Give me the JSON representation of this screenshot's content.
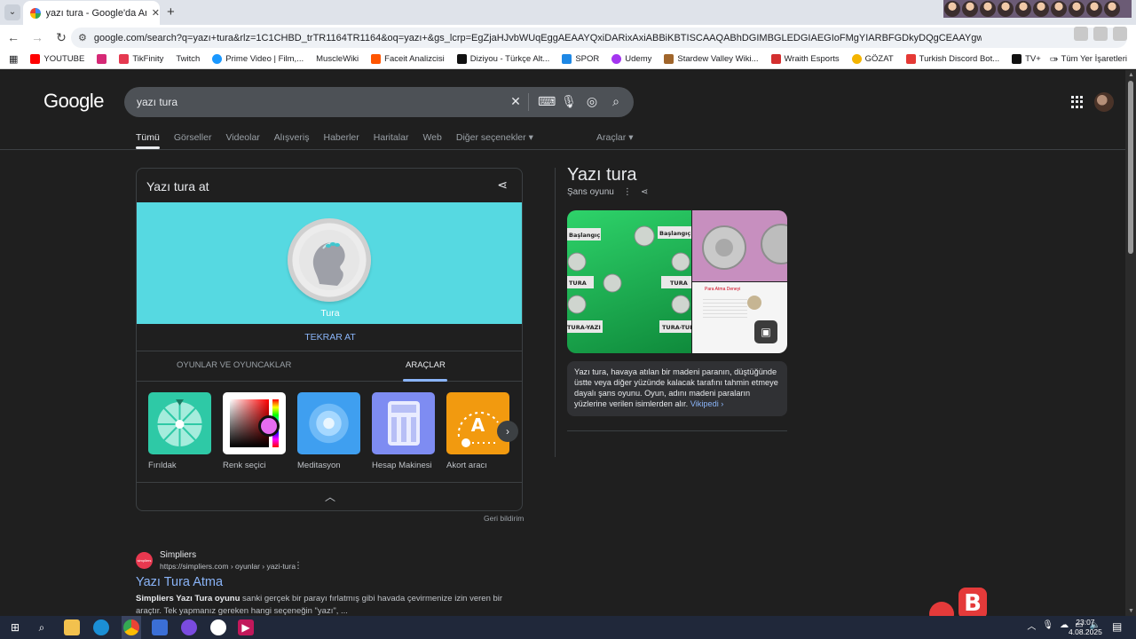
{
  "browser": {
    "tab_title": "yazı tura - Google'da Ara",
    "url": "google.com/search?q=yazı+tura&rlz=1C1CHBD_trTR1164TR1164&oq=yazı+&gs_lcrp=EgZjaHJvbWUqEggAEAAYQxiDARixAxiABBiKBTISCAAQABhDGIMBGLEDGIAEGIoFMgYIARBFGDkyDQgCEAAYgwEYsQMYgAQyDQgDEAAYgwEYsQMYgAQyDQgEEAAYgwEYsQMYg...",
    "bookmarks": [
      "YOUTUBE",
      "TikFinity",
      "Twitch",
      "Prime Video | Film,...",
      "MuscleWiki",
      "Faceit Analizcisi",
      "Diziyou - Türkçe Alt...",
      "SPOR",
      "Udemy",
      "Stardew Valley Wiki...",
      "Wraith Esports",
      "GÖZAT",
      "Turkish Discord Bot...",
      "TV+"
    ],
    "bookmarks_more": "»",
    "all_bookmarks": "Tüm Yer İşaretleri"
  },
  "search": {
    "logo": "Google",
    "query": "yazı tura",
    "tabs": [
      "Tümü",
      "Görseller",
      "Videolar",
      "Alışveriş",
      "Haberler",
      "Haritalar",
      "Web",
      "Diğer seçenekler"
    ],
    "tools": "Araçlar"
  },
  "coin_flip": {
    "title": "Yazı tura at",
    "result": "Tura",
    "flip_again": "TEKRAR AT",
    "tab_games": "OYUNLAR VE OYUNCAKLAR",
    "tab_tools": "ARAÇLAR",
    "tools": [
      {
        "label": "Fırıldak"
      },
      {
        "label": "Renk seçici"
      },
      {
        "label": "Meditasyon"
      },
      {
        "label": "Hesap Makinesi"
      },
      {
        "label": "Akort aracı"
      }
    ],
    "feedback": "Geri bildirim"
  },
  "result": {
    "site_name": "Simpliers",
    "site_url": "https://simpliers.com › oyunlar › yazi-tura",
    "title": "Yazı Tura Atma",
    "snippet_bold": "Simpliers Yazı Tura oyunu",
    "snippet_rest": " sanki gerçek bir parayı fırlatmış gibi havada çevirmenize izin veren bir araçtır. Tek yapmanız gereken hangi seçeneğin \"yazı\", ..."
  },
  "knowledge_panel": {
    "title": "Yazı tura",
    "subtitle": "Şans oyunu",
    "description": "Yazı tura, havaya atılan bir madeni paranın, düştüğünde üstte veya diğer yüzünde kalacak tarafını tahmin etmeye dayalı şans oyunu. Oyun, adını madeni paraların yüzlerine verilen isimlerden alır.",
    "wiki_link": "Vikipedi ›",
    "diagram_labels": [
      "Başlangıç",
      "Başlangıç",
      "TURA",
      "TURA",
      "TURA-YAZI",
      "TURA-TURA"
    ],
    "experiment_label": "Para Atma Deneyi"
  },
  "taskbar": {
    "time": "23:07",
    "date": "4.08.2025"
  },
  "colors": {
    "page_bg": "#1f1f1f",
    "coin_stage": "#56d9e1",
    "link": "#8ab4f8"
  }
}
